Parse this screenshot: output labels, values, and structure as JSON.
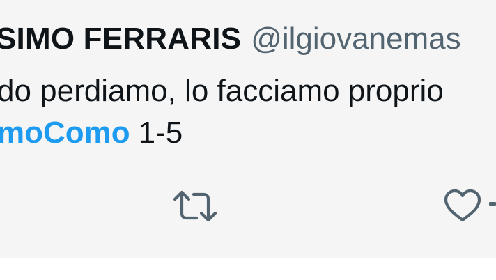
{
  "tweet": {
    "author_name": "SIMO FERRARIS",
    "author_handle": "@ilgiovanemas",
    "text_line_1": "do perdiamo, lo facciamo proprio",
    "hashtag": "moComo",
    "score": "1-5"
  },
  "actions": {
    "retweet_icon": "retweet-icon",
    "like_icon": "heart-icon"
  },
  "colors": {
    "background": "#f5f5f5",
    "text": "#0f1419",
    "secondary": "#536471",
    "accent": "#1d9bf0"
  }
}
